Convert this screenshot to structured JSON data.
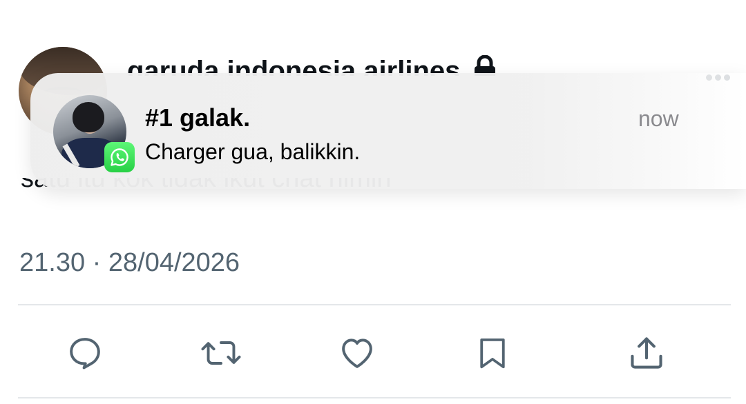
{
  "tweet": {
    "author_name": "garuda indonesia airlines",
    "text": "satu itu kok tidak ikut chat nimin",
    "timestamp": "21.30 · 28/04/2026"
  },
  "actions": {
    "reply": "reply-icon",
    "retweet": "retweet-icon",
    "like": "heart-icon",
    "bookmark": "bookmark-icon",
    "share": "share-icon"
  },
  "notification": {
    "app": "WhatsApp",
    "sender": "#1 galak.",
    "message": "Charger gua, balikkin.",
    "time": "now"
  },
  "colors": {
    "text": "#0f1419",
    "secondary": "#536471",
    "whatsapp_green": "#27d045",
    "icon_gray": "#536471"
  }
}
